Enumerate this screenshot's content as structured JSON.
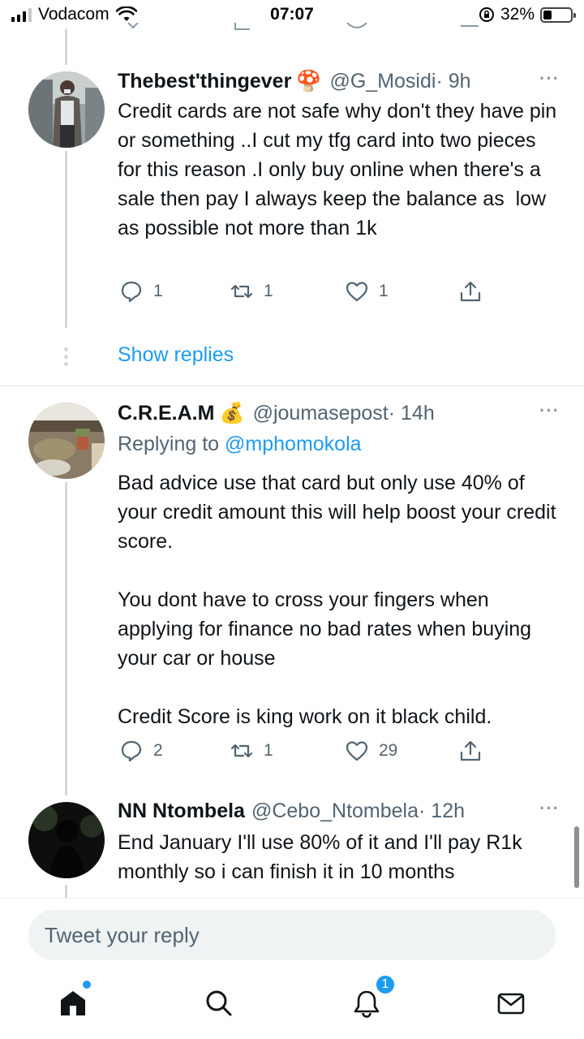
{
  "status_bar": {
    "carrier": "Vodacom",
    "time": "07:07",
    "battery": "32%",
    "battery_level": 0.32
  },
  "tweets": [
    {
      "name": "Thebest'thingever",
      "emoji": "🍄",
      "handle": "@G_Mosidi",
      "time": "· 9h",
      "text": "Credit cards are not safe why don't they have pin or something ..I cut my tfg card into two pieces for this reason .I only buy online when there's a sale then pay I always keep the balance as  low as possible not more than 1k",
      "replies": "1",
      "retweets": "1",
      "likes": "1"
    },
    {
      "name": "C.R.E.A.M",
      "emoji": "💰",
      "handle": "@joumasepost",
      "time": "· 14h",
      "replying_label": "Replying to",
      "replying_to": "@mphomokola",
      "text": "Bad advice use that card but only use 40% of your credit amount this will help boost your credit score.\n\nYou dont have to cross your fingers when applying for finance no bad rates when buying your car or house\n\nCredit Score is king work on it black child.",
      "replies": "2",
      "retweets": "1",
      "likes": "29"
    },
    {
      "name": "NN Ntombela",
      "handle": "@Cebo_Ntombela",
      "time": "· 12h",
      "text": "End January I'll use 80% of it and I'll pay R1k monthly so i can finish it in 10 months"
    }
  ],
  "show_replies": "Show replies",
  "more_label": "···",
  "reply_bar": {
    "placeholder": "Tweet your reply"
  },
  "bottom_nav": {
    "notifications_count": "1"
  },
  "colors": {
    "accent": "#1d9bf0",
    "secondary_text": "#536471"
  }
}
